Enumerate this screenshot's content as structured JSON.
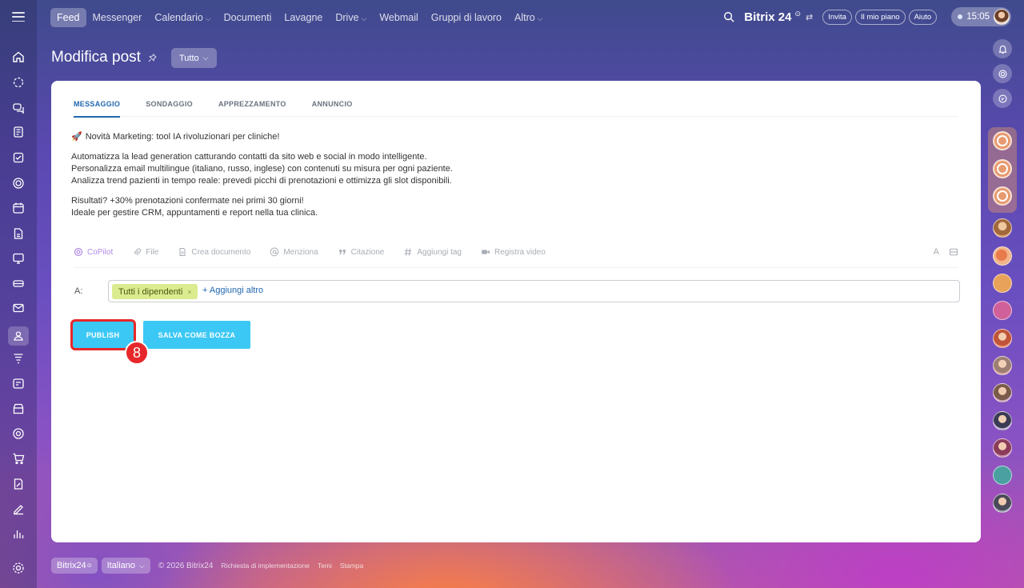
{
  "nav": {
    "items": [
      {
        "label": "Feed",
        "active": true,
        "chevron": false
      },
      {
        "label": "Messenger",
        "active": false,
        "chevron": false
      },
      {
        "label": "Calendario",
        "active": false,
        "chevron": true
      },
      {
        "label": "Documenti",
        "active": false,
        "chevron": false
      },
      {
        "label": "Lavagne",
        "active": false,
        "chevron": false
      },
      {
        "label": "Drive",
        "active": false,
        "chevron": true
      },
      {
        "label": "Webmail",
        "active": false,
        "chevron": false
      },
      {
        "label": "Gruppi di lavoro",
        "active": false,
        "chevron": false
      },
      {
        "label": "Altro",
        "active": false,
        "chevron": true
      }
    ],
    "brand": "Bitrix 24",
    "brand_sup": "⊙",
    "brand_swap": "⇄",
    "invite": "Invita",
    "plan": "Il mio piano",
    "help": "Aiuto",
    "time": "15:05"
  },
  "page": {
    "title": "Modifica post",
    "filter": "Tutto"
  },
  "tabs": [
    {
      "label": "MESSAGGIO",
      "active": true
    },
    {
      "label": "SONDAGGIO",
      "active": false
    },
    {
      "label": "APPREZZAMENTO",
      "active": false
    },
    {
      "label": "ANNUNCIO",
      "active": false
    }
  ],
  "message": {
    "headline": "Novità Marketing: tool IA rivoluzionari per cliniche!",
    "rocket": "🚀",
    "line1": "Automatizza la lead generation catturando contatti da sito web e social in modo intelligente.",
    "line2": "Personalizza email multilingue (italiano, russo, inglese) con contenuti su misura per ogni paziente.",
    "line3": "Analizza trend pazienti in tempo reale: prevedi picchi di prenotazioni e ottimizza gli slot disponibili.",
    "line4": "Risultati? +30% prenotazioni confermate nei primi 30 giorni!",
    "line5": "Ideale per gestire CRM, appuntamenti e report nella tua clinica."
  },
  "toolbar": {
    "copilot": "CoPilot",
    "file": "File",
    "create_doc": "Crea documento",
    "mention": "Menziona",
    "quote": "Citazione",
    "tag": "Aggiungi tag",
    "video": "Registra video",
    "font_btn": "A"
  },
  "recipients": {
    "label": "A:",
    "chip": "Tutti i dipendenti",
    "chip_remove": "×",
    "add_more": "+ Aggiungi altro"
  },
  "actions": {
    "publish": "PUBLISH",
    "draft": "SALVA COME BOZZA",
    "step": "8"
  },
  "footer": {
    "brand": "Bitrix24",
    "brand_sup": "⊙",
    "language": "Italiano",
    "copyright": "© 2026 Bitrix24",
    "implementation": "Richiesta di implementazione",
    "themes": "Temi",
    "print": "Stampa"
  },
  "colors": {
    "accent_blue": "#2067b0",
    "button_cyan": "#3bc8f5",
    "highlight_red": "#e8272a",
    "chip_green": "#dbeb8f"
  }
}
